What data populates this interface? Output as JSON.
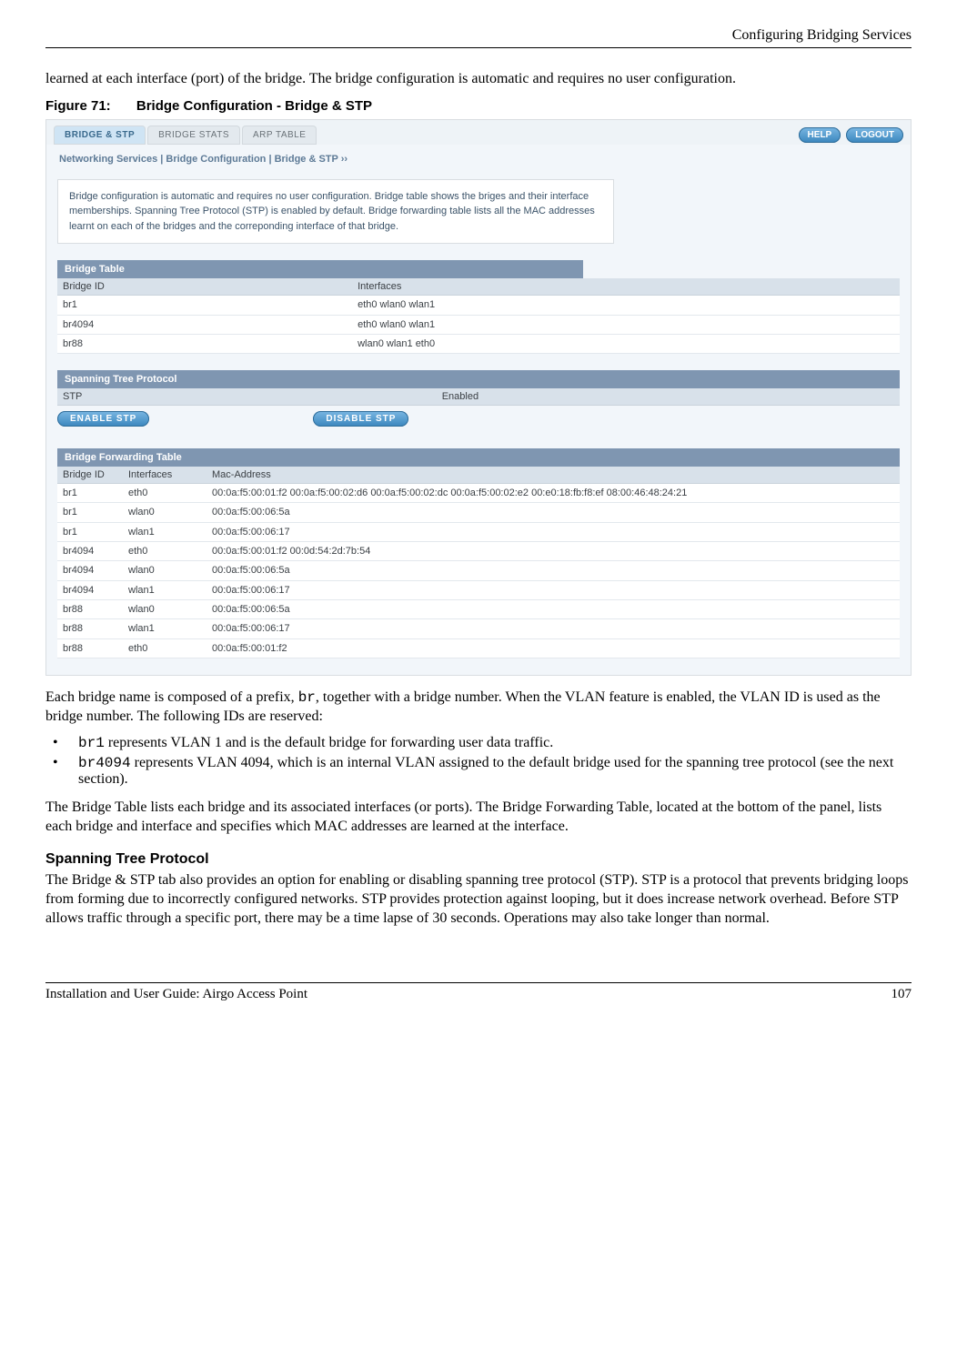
{
  "header": {
    "chapter_title": "Configuring Bridging Services"
  },
  "para1": "learned at each interface (port) of the bridge. The bridge configuration is automatic and requires no user configuration.",
  "figcap_num": "Figure 71:",
  "figcap_title": "Bridge Configuration - Bridge & STP",
  "screenshot": {
    "tabs": {
      "t1": "BRIDGE & STP",
      "t2": "BRIDGE STATS",
      "t3": "ARP TABLE"
    },
    "buttons": {
      "help": "HELP",
      "logout": "LOGOUT"
    },
    "breadcrumb": "Networking Services | Bridge Configuration | Bridge & STP  ››",
    "description": "Bridge configuration is automatic and requires no user configuration. Bridge table shows the briges and their interface memberships. Spanning Tree Protocol (STP) is enabled by default. Bridge forwarding table lists all the MAC addresses learnt on each of the bridges and the correponding interface of that bridge.",
    "bridgeTable": {
      "title": "Bridge Table",
      "headers": {
        "h1": "Bridge ID",
        "h2": "Interfaces"
      },
      "rows": [
        {
          "c1": "br1",
          "c2": "eth0 wlan0 wlan1"
        },
        {
          "c1": "br4094",
          "c2": "eth0 wlan0 wlan1"
        },
        {
          "c1": "br88",
          "c2": "wlan0 wlan1 eth0"
        }
      ]
    },
    "stp": {
      "title": "Spanning Tree Protocol",
      "label": "STP",
      "value": "Enabled",
      "enable_btn": "ENABLE STP",
      "disable_btn": "DISABLE STP"
    },
    "fwdTable": {
      "title": "Bridge Forwarding Table",
      "headers": {
        "h1": "Bridge ID",
        "h2": "Interfaces",
        "h3": "Mac-Address"
      },
      "rows": [
        {
          "c1": "br1",
          "c2": "eth0",
          "c3": "00:0a:f5:00:01:f2 00:0a:f5:00:02:d6 00:0a:f5:00:02:dc 00:0a:f5:00:02:e2 00:e0:18:fb:f8:ef 08:00:46:48:24:21"
        },
        {
          "c1": "br1",
          "c2": "wlan0",
          "c3": "00:0a:f5:00:06:5a"
        },
        {
          "c1": "br1",
          "c2": "wlan1",
          "c3": "00:0a:f5:00:06:17"
        },
        {
          "c1": "br4094",
          "c2": "eth0",
          "c3": "00:0a:f5:00:01:f2 00:0d:54:2d:7b:54"
        },
        {
          "c1": "br4094",
          "c2": "wlan0",
          "c3": "00:0a:f5:00:06:5a"
        },
        {
          "c1": "br4094",
          "c2": "wlan1",
          "c3": "00:0a:f5:00:06:17"
        },
        {
          "c1": "br88",
          "c2": "wlan0",
          "c3": "00:0a:f5:00:06:5a"
        },
        {
          "c1": "br88",
          "c2": "wlan1",
          "c3": "00:0a:f5:00:06:17"
        },
        {
          "c1": "br88",
          "c2": "eth0",
          "c3": "00:0a:f5:00:01:f2"
        }
      ]
    }
  },
  "para2a": "Each bridge name is composed of a prefix, ",
  "para2_code": "br",
  "para2b": ", together with a bridge number. When the VLAN feature is enabled, the VLAN ID is used as the bridge number. The following IDs are reserved:",
  "bullet1_code": "br1",
  "bullet1_text": " represents VLAN 1 and is the default bridge for forwarding user data traffic.",
  "bullet2_code": "br4094",
  "bullet2_text": " represents VLAN 4094, which is an internal VLAN assigned to the default bridge used for the spanning tree protocol (see the next section).",
  "para3": "The Bridge Table lists each bridge and its associated interfaces (or ports). The Bridge Forwarding Table, located at the bottom of the panel, lists each bridge and interface and specifies which MAC addresses are learned at the interface.",
  "subhead": "Spanning Tree Protocol",
  "para4": "The Bridge & STP tab also provides an option for enabling or disabling spanning tree protocol (STP). STP is a protocol that prevents bridging loops from forming due to incorrectly configured networks. STP provides protection against looping, but it does increase network overhead. Before STP allows traffic through a specific port, there may be a time lapse of 30 seconds. Operations may also take longer than normal.",
  "footer": {
    "left": "Installation and User Guide: Airgo Access Point",
    "right": "107"
  }
}
